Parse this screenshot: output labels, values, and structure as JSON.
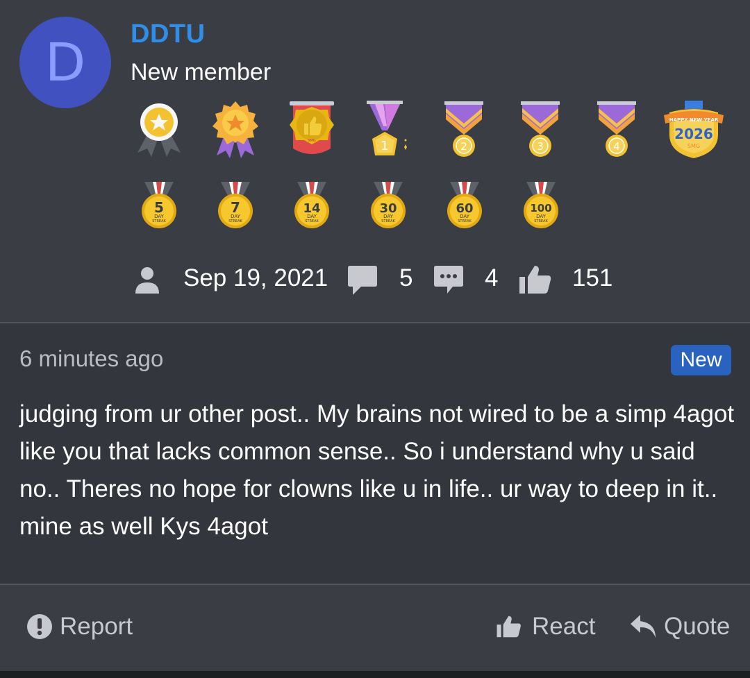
{
  "user": {
    "avatar_letter": "D",
    "name": "DDTU",
    "title": "New member"
  },
  "badges": {
    "happy_new_year_text": "HAPPY NEW YEAR",
    "year": "2026",
    "smg": "SMG",
    "streaks": [
      {
        "number": "5",
        "line1": "DAY",
        "line2": "STREAK"
      },
      {
        "number": "7",
        "line1": "DAY",
        "line2": "STREAK"
      },
      {
        "number": "14",
        "line1": "DAY",
        "line2": "STREAK"
      },
      {
        "number": "30",
        "line1": "DAY",
        "line2": "STREAK"
      },
      {
        "number": "60",
        "line1": "DAY",
        "line2": "STREAK"
      },
      {
        "number": "100",
        "line1": "DAY",
        "line2": "STREAK"
      }
    ],
    "medal_numbers": [
      "1",
      "2",
      "3",
      "4"
    ]
  },
  "stats": {
    "join_date": "Sep 19, 2021",
    "messages": "5",
    "comments": "4",
    "reactions": "151"
  },
  "post": {
    "time": "6 minutes ago",
    "new_label": "New",
    "content": "judging from ur other post.. My brains not wired to be a simp 4agot like you that lacks common sense.. So i understand why u said no.. Theres no hope for clowns like u in life.. ur way to deep in it.. mine as well Kys 4agot"
  },
  "actions": {
    "report": "Report",
    "react": "React",
    "quote": "Quote"
  },
  "colors": {
    "background": "#3a3d44",
    "post_background": "#33363d",
    "username": "#2f8fe8",
    "new_badge": "#2a63bf",
    "avatar": "#4152c0",
    "gold": "#f2c230",
    "purple": "#9b6ad8"
  }
}
